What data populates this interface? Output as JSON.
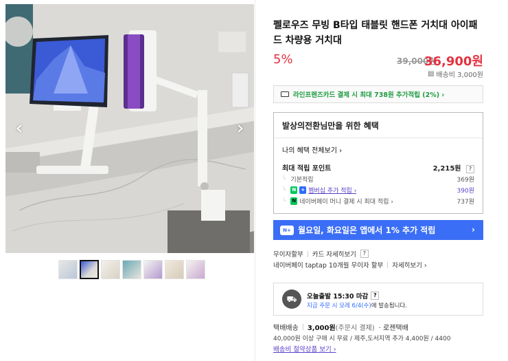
{
  "gallery": {
    "prev_arrow": "‹",
    "next_arrow": "›",
    "thumbnail_count": 7
  },
  "product": {
    "title": "펠로우즈 무빙 B타입 태블릿 핸드폰 거치대 아이패드 차량용 거치대",
    "discount_rate": "5%",
    "original_price": "39,000원",
    "sale_price": "36,900원",
    "shipping_fee": "배송비 3,000원"
  },
  "card_banner": {
    "text": "라인프렌즈카드 결제 시 최대 738원 추가적립 (2%) ›"
  },
  "benefits": {
    "header": "발상의전환님만을 위한 혜택",
    "my_benefits_link": "나의 혜택 전체보기 ›",
    "max_points_label": "최대 적립 포인트",
    "max_points_value": "2,215원",
    "help": "?",
    "rows": [
      {
        "label": "기본적립",
        "value": "369원"
      },
      {
        "badge1": "N",
        "badge2": "+",
        "label": "멤버십 추가 적립 ›",
        "value": "390원"
      },
      {
        "badge1": "N",
        "label": "네이버페이 머니 결제 시 최대 적립 ›",
        "value": "737원"
      }
    ]
  },
  "app_banner": {
    "icon": "N+",
    "text": "월요일, 화요일은 앱에서 1% 추가 적립",
    "chevron": "›"
  },
  "installment": {
    "label1": "무이자할부",
    "label2": "카드 자세히보기",
    "help": "?",
    "line2": "네이버페이 taptap 10개월 무이자 할부",
    "line2_link": "자세히보기 ›"
  },
  "delivery": {
    "truck_icon": "⛟",
    "title": "오늘출발 15:30 마감",
    "help": "?",
    "desc_prefix": "지금 주문 시 모레 6/4(수)",
    "desc_suffix": "에 발송됩니다."
  },
  "shipping": {
    "type": "택배배송",
    "price": "3,000원",
    "condition": "(주문시 결제)",
    "carrier": "· 로젠택배",
    "info": "40,000원 이상 구매 시 무료 / 제주,도서지역 추가 4,400원 / 4400",
    "bundle_link": "배송비 절약상품 보기 ›"
  },
  "colors": {
    "accent_red": "#e4313f",
    "naver_green": "#03c75a",
    "app_blue": "#3b6ef6",
    "membership_purple": "#5a3ec8"
  }
}
